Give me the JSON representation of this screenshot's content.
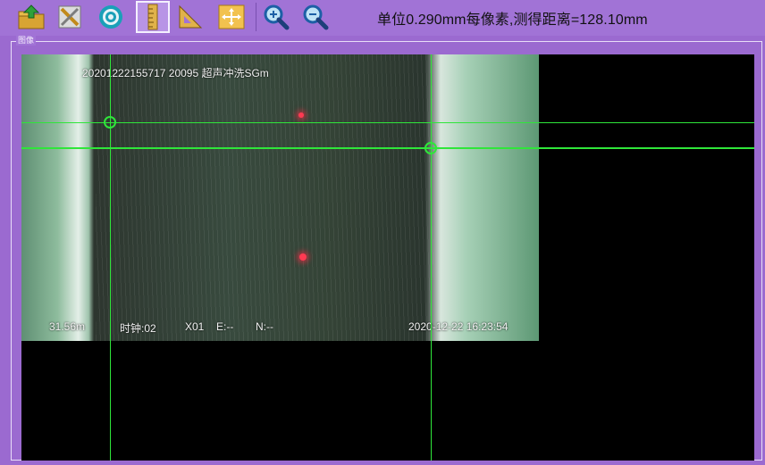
{
  "toolbar": {
    "buttons": [
      {
        "name": "open-image-button",
        "icon": "folder-up-icon",
        "active": false
      },
      {
        "name": "clear-button",
        "icon": "eraser-icon",
        "active": false
      },
      {
        "name": "circle-measure-button",
        "icon": "target-circle-icon",
        "active": false
      },
      {
        "name": "ruler-measure-button",
        "icon": "ruler-icon",
        "active": true
      },
      {
        "name": "angle-measure-button",
        "icon": "set-square-icon",
        "active": false
      },
      {
        "name": "pan-button",
        "icon": "move-arrows-icon",
        "active": false
      },
      {
        "name": "zoom-in-button",
        "icon": "zoom-in-icon",
        "active": false
      },
      {
        "name": "zoom-out-button",
        "icon": "zoom-out-icon",
        "active": false
      }
    ],
    "unit_info": "单位0.290mm每像素,测得距离=128.10mm"
  },
  "panel": {
    "group_label": "图像"
  },
  "camera_overlay": {
    "top_text": "20201222155717   20095   超声冲洗SGm",
    "distance": "31.56m",
    "time": "时钟:02",
    "sensor": "X01",
    "east": "E:--",
    "north": "N:--",
    "datetime": "2020-12-22  16:23:54"
  },
  "colors": {
    "toolbar_bg": "#a173d6",
    "window_bg": "#9b6ad0",
    "crosshair": "#2fe63a",
    "viewport_bg": "#000000",
    "laser_point": "#ff3a52"
  }
}
